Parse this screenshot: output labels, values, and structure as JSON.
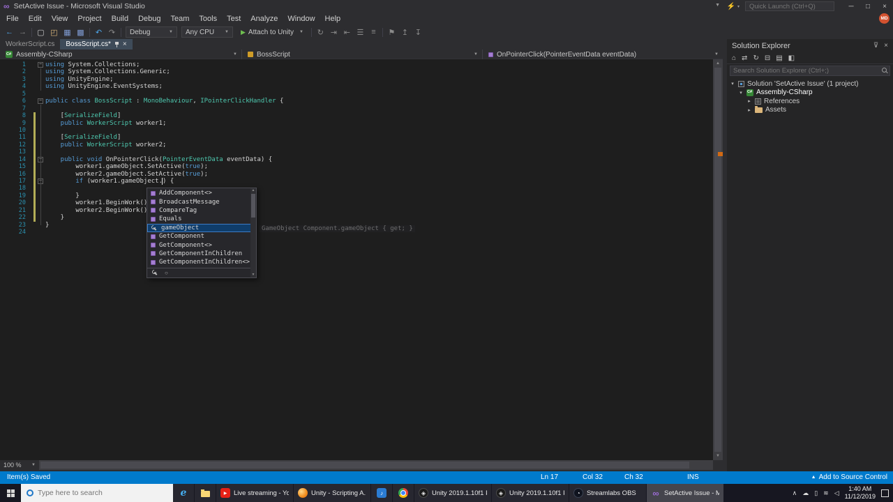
{
  "window": {
    "title": "SetActive Issue - Microsoft Visual Studio",
    "quick_launch": "Quick Launch (Ctrl+Q)",
    "avatar": "MD"
  },
  "menu_bar": {
    "items": [
      "File",
      "Edit",
      "View",
      "Project",
      "Build",
      "Debug",
      "Team",
      "Tools",
      "Test",
      "Analyze",
      "Window",
      "Help"
    ]
  },
  "toolbar": {
    "config": "Debug",
    "platform": "Any CPU",
    "attach": "Attach to Unity",
    "left_icons": [
      {
        "name": "navigate-backward-icon",
        "glyph": "←",
        "color": "#4ea6ea"
      },
      {
        "name": "navigate-forward-icon",
        "glyph": "→",
        "color": "#8a8a8a"
      },
      {
        "sep": true
      },
      {
        "name": "new-file-icon",
        "glyph": "▢",
        "color": "#c8c8c8"
      },
      {
        "name": "open-file-icon",
        "glyph": "◰",
        "color": "#dcb67a"
      },
      {
        "name": "save-icon",
        "glyph": "▦",
        "color": "#7e9ad1"
      },
      {
        "name": "save-all-icon",
        "glyph": "▩",
        "color": "#7e9ad1"
      },
      {
        "sep": true
      },
      {
        "name": "undo-icon",
        "glyph": "↶",
        "color": "#4ea6ea"
      },
      {
        "name": "redo-icon",
        "glyph": "↷",
        "color": "#8a8a8a"
      },
      {
        "sep": true
      }
    ],
    "right_icons": [
      {
        "sep": true
      },
      {
        "name": "step-over-icon",
        "glyph": "↻",
        "color": "#8a8a8a"
      },
      {
        "name": "indent-icon",
        "glyph": "⇥",
        "color": "#8a8a8a"
      },
      {
        "name": "outdent-icon",
        "glyph": "⇤",
        "color": "#8a8a8a"
      },
      {
        "name": "comment-icon",
        "glyph": "☰",
        "color": "#8a8a8a"
      },
      {
        "name": "uncomment-icon",
        "glyph": "≡",
        "color": "#8a8a8a"
      },
      {
        "sep": true
      },
      {
        "name": "bookmark-icon",
        "glyph": "⚑",
        "color": "#8a8a8a"
      },
      {
        "name": "prev-bookmark-icon",
        "glyph": "↥",
        "color": "#8a8a8a"
      },
      {
        "name": "next-bookmark-icon",
        "glyph": "↧",
        "color": "#8a8a8a"
      }
    ]
  },
  "tabs": [
    {
      "label": "WorkerScript.cs",
      "active": false
    },
    {
      "label": "BossScript.cs*",
      "active": true
    }
  ],
  "navbar": {
    "project": "Assembly-CSharp",
    "type": "BossScript",
    "member": "OnPointerClick(PointerEventData eventData)"
  },
  "editor": {
    "zoom": "100 %",
    "lines": [
      {
        "fold": true,
        "tokens": [
          {
            "c": "k",
            "t": "using"
          },
          {
            "c": "p",
            "t": " System.Collections;"
          }
        ]
      },
      {
        "tokens": [
          {
            "c": "k",
            "t": "using"
          },
          {
            "c": "p",
            "t": " System.Collections.Generic;"
          }
        ]
      },
      {
        "tokens": [
          {
            "c": "k",
            "t": "using"
          },
          {
            "c": "p",
            "t": " UnityEngine;"
          }
        ]
      },
      {
        "tokens": [
          {
            "c": "k",
            "t": "using"
          },
          {
            "c": "p",
            "t": " UnityEngine.EventSystems;"
          }
        ]
      },
      {
        "tokens": []
      },
      {
        "fold": true,
        "tokens": [
          {
            "c": "k",
            "t": "public class "
          },
          {
            "c": "t",
            "t": "BossScript"
          },
          {
            "c": "p",
            "t": " : "
          },
          {
            "c": "t",
            "t": "MonoBehaviour"
          },
          {
            "c": "p",
            "t": ", "
          },
          {
            "c": "t",
            "t": "IPointerClickHandler"
          },
          {
            "c": "p",
            "t": " {"
          }
        ]
      },
      {
        "tokens": []
      },
      {
        "chg": true,
        "tokens": [
          {
            "c": "p",
            "t": "    ["
          },
          {
            "c": "t",
            "t": "SerializeField"
          },
          {
            "c": "p",
            "t": "]"
          }
        ]
      },
      {
        "chg": true,
        "tokens": [
          {
            "c": "k",
            "t": "    public "
          },
          {
            "c": "t",
            "t": "WorkerScript"
          },
          {
            "c": "p",
            "t": " worker1;"
          }
        ]
      },
      {
        "chg": true,
        "tokens": []
      },
      {
        "chg": true,
        "tokens": [
          {
            "c": "p",
            "t": "    ["
          },
          {
            "c": "t",
            "t": "SerializeField"
          },
          {
            "c": "p",
            "t": "]"
          }
        ]
      },
      {
        "chg": true,
        "tokens": [
          {
            "c": "k",
            "t": "    public "
          },
          {
            "c": "t",
            "t": "WorkerScript"
          },
          {
            "c": "p",
            "t": " worker2;"
          }
        ]
      },
      {
        "chg": true,
        "tokens": []
      },
      {
        "chg": true,
        "fold": true,
        "tokens": [
          {
            "c": "k",
            "t": "    public void "
          },
          {
            "c": "p",
            "t": "OnPointerClick("
          },
          {
            "c": "t",
            "t": "PointerEventData"
          },
          {
            "c": "p",
            "t": " eventData) {"
          }
        ]
      },
      {
        "chg": true,
        "tokens": [
          {
            "c": "p",
            "t": "        worker1.gameObject.SetActive("
          },
          {
            "c": "k",
            "t": "true"
          },
          {
            "c": "p",
            "t": ");"
          }
        ]
      },
      {
        "chg": true,
        "tokens": [
          {
            "c": "p",
            "t": "        worker2.gameObject.SetActive("
          },
          {
            "c": "k",
            "t": "true"
          },
          {
            "c": "p",
            "t": ");"
          }
        ]
      },
      {
        "chg": true,
        "fold": true,
        "tokens": [
          {
            "c": "p",
            "t": "        "
          },
          {
            "c": "k",
            "t": "if"
          },
          {
            "c": "p",
            "t": " (worker1.gameObject.) {"
          }
        ]
      },
      {
        "chg": true,
        "tokens": []
      },
      {
        "chg": true,
        "tokens": [
          {
            "c": "p",
            "t": "        }"
          }
        ]
      },
      {
        "chg": true,
        "tokens": [
          {
            "c": "p",
            "t": "        worker1.BeginWork();"
          }
        ]
      },
      {
        "chg": true,
        "tokens": [
          {
            "c": "p",
            "t": "        worker2.BeginWork();"
          }
        ]
      },
      {
        "chg": true,
        "tokens": [
          {
            "c": "p",
            "t": "    }"
          }
        ]
      },
      {
        "tokens": [
          {
            "c": "p",
            "t": "}"
          }
        ]
      },
      {
        "tokens": []
      }
    ]
  },
  "intellisense": {
    "items": [
      {
        "label": "AddComponent<>",
        "kind": "method"
      },
      {
        "label": "BroadcastMessage",
        "kind": "method"
      },
      {
        "label": "CompareTag",
        "kind": "method"
      },
      {
        "label": "Equals",
        "kind": "method"
      },
      {
        "label": "gameObject",
        "kind": "property",
        "selected": true
      },
      {
        "label": "GetComponent",
        "kind": "method"
      },
      {
        "label": "GetComponent<>",
        "kind": "method"
      },
      {
        "label": "GetComponentInChildren",
        "kind": "method"
      },
      {
        "label": "GetComponentInChildren<>",
        "kind": "method"
      }
    ],
    "tooltip": "GameObject Component.gameObject { get; }"
  },
  "solution_explorer": {
    "title": "Solution Explorer",
    "search_placeholder": "Search Solution Explorer (Ctrl+;)",
    "toolbar": [
      {
        "name": "home-icon",
        "glyph": "⌂"
      },
      {
        "name": "sync-active-document-icon",
        "glyph": "⇄"
      },
      {
        "name": "refresh-icon",
        "glyph": "↻"
      },
      {
        "name": "collapse-all-icon",
        "glyph": "⊟"
      },
      {
        "name": "properties-icon",
        "glyph": "▤"
      },
      {
        "name": "show-all-files-icon",
        "glyph": "◧"
      }
    ],
    "tree": [
      {
        "indent": 0,
        "arrow": "expanded",
        "icon": "solution",
        "label": "Solution 'SetActive Issue' (1 project)"
      },
      {
        "indent": 1,
        "arrow": "expanded",
        "icon": "csproject",
        "label": "Assembly-CSharp",
        "bold": true
      },
      {
        "indent": 2,
        "arrow": "collapsed",
        "icon": "references",
        "label": "References"
      },
      {
        "indent": 2,
        "arrow": "collapsed",
        "icon": "folder",
        "label": "Assets"
      }
    ]
  },
  "status_bar": {
    "message": "Item(s) Saved",
    "ln": "Ln 17",
    "col": "Col 32",
    "ch": "Ch 32",
    "mode": "INS",
    "source_control": "Add to Source Control"
  },
  "taskbar": {
    "search_placeholder": "Type here to search",
    "apps": [
      {
        "icon": "edge",
        "label": ""
      },
      {
        "icon": "explorer",
        "label": ""
      },
      {
        "icon": "youtube",
        "label": "Live streaming - Yo..."
      },
      {
        "icon": "browser",
        "label": "Unity - Scripting A..."
      },
      {
        "icon": "media",
        "label": ""
      },
      {
        "icon": "chrome",
        "label": ""
      },
      {
        "icon": "unity",
        "label": "Unity 2019.1.10f1 P..."
      },
      {
        "icon": "unity",
        "label": "Unity 2019.1.10f1 P..."
      },
      {
        "icon": "obs",
        "label": "Streamlabs OBS"
      },
      {
        "icon": "vs",
        "label": "SetActive Issue - M...",
        "active": true
      }
    ],
    "tray": [
      {
        "name": "tray-expand-icon",
        "glyph": "∧"
      },
      {
        "name": "cloud-icon",
        "glyph": "☁"
      },
      {
        "name": "battery-icon",
        "glyph": "▯"
      },
      {
        "name": "network-icon",
        "glyph": "≋"
      },
      {
        "name": "volume-icon",
        "glyph": "◁"
      }
    ],
    "clock": {
      "time": "1:40 AM",
      "date": "11/12/2019"
    }
  }
}
